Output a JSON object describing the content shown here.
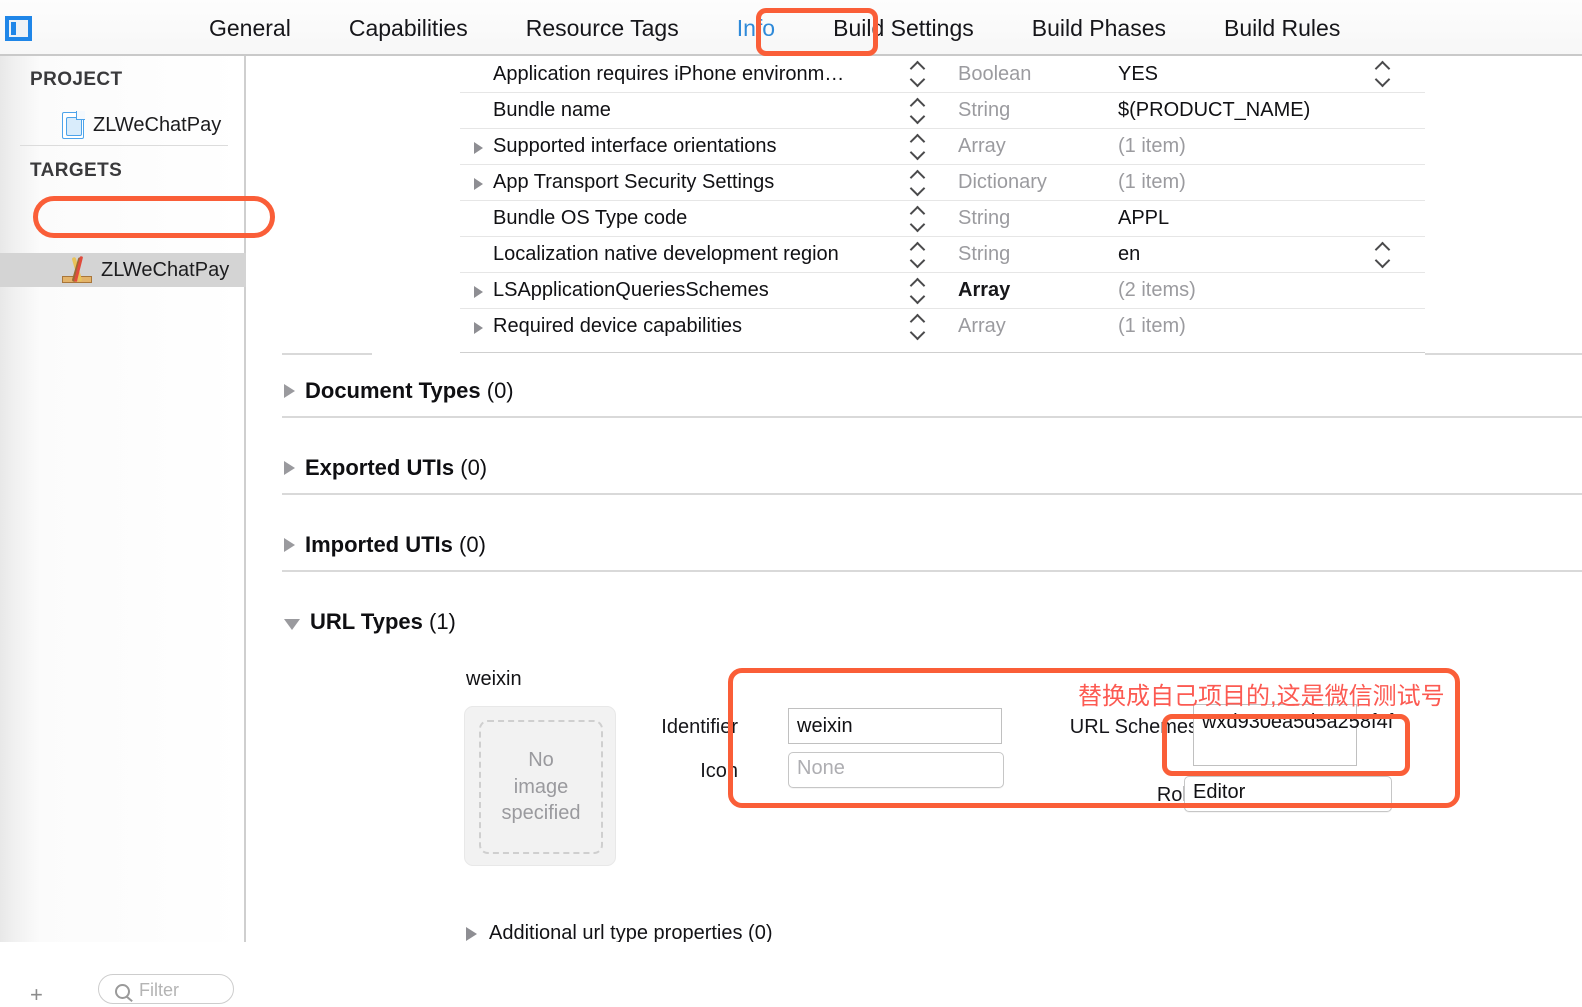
{
  "window": {
    "sidebar_toggle_icon": "sidebar-toggle-icon"
  },
  "tabs": [
    {
      "label": "General",
      "active": false
    },
    {
      "label": "Capabilities",
      "active": false
    },
    {
      "label": "Resource Tags",
      "active": false
    },
    {
      "label": "Info",
      "active": true
    },
    {
      "label": "Build Settings",
      "active": false
    },
    {
      "label": "Build Phases",
      "active": false
    },
    {
      "label": "Build Rules",
      "active": false
    }
  ],
  "sidebar": {
    "project_header": "PROJECT",
    "project_item": {
      "label": "ZLWeChatPay",
      "icon": "xcode-project-icon"
    },
    "targets_header": "TARGETS",
    "target_item": {
      "label": "ZLWeChatPay",
      "icon": "app-target-icon",
      "selected": true
    },
    "filter_placeholder": "Filter",
    "filter_icon": "search-icon",
    "add_button": "+"
  },
  "plist": {
    "rows": [
      {
        "key": "Application requires iPhone environm…",
        "type": "Boolean",
        "value": "YES",
        "type_strong": false,
        "value_muted": false,
        "disclosure": false,
        "value_stepper": true
      },
      {
        "key": "Bundle name",
        "type": "String",
        "value": "$(PRODUCT_NAME)",
        "type_strong": false,
        "value_muted": false,
        "disclosure": false,
        "value_stepper": false
      },
      {
        "key": "Supported interface orientations",
        "type": "Array",
        "value": "(1 item)",
        "type_strong": false,
        "value_muted": true,
        "disclosure": true,
        "value_stepper": false
      },
      {
        "key": "App Transport Security Settings",
        "type": "Dictionary",
        "value": "(1 item)",
        "type_strong": false,
        "value_muted": true,
        "disclosure": true,
        "value_stepper": false
      },
      {
        "key": "Bundle OS Type code",
        "type": "String",
        "value": "APPL",
        "type_strong": false,
        "value_muted": false,
        "disclosure": false,
        "value_stepper": false
      },
      {
        "key": "Localization native development region",
        "type": "String",
        "value": "en",
        "type_strong": false,
        "value_muted": false,
        "disclosure": false,
        "value_stepper": true
      },
      {
        "key": "LSApplicationQueriesSchemes",
        "type": "Array",
        "value": "(2 items)",
        "type_strong": true,
        "value_muted": true,
        "disclosure": true,
        "value_stepper": false
      },
      {
        "key": "Required device capabilities",
        "type": "Array",
        "value": "(1 item)",
        "type_strong": false,
        "value_muted": true,
        "disclosure": true,
        "value_stepper": false
      }
    ]
  },
  "sections": [
    {
      "title": "Document Types ",
      "count": "(0)",
      "expanded": false
    },
    {
      "title": "Exported UTIs ",
      "count": "(0)",
      "expanded": false
    },
    {
      "title": "Imported UTIs ",
      "count": "(0)",
      "expanded": false
    },
    {
      "title": "URL Types ",
      "count": "(1)",
      "expanded": true
    }
  ],
  "url_type": {
    "name": "weixin",
    "image_well_text": "No\nimage\nspecified",
    "image_well_line1": "No",
    "image_well_line2": "image",
    "image_well_line3": "specified",
    "identifier_label": "Identifier",
    "identifier_value": "weixin",
    "icon_label": "Icon",
    "icon_value": "None",
    "url_schemes_label": "URL Schemes",
    "url_schemes_value": "wxd930ea5d5a258f4f",
    "role_label": "Role",
    "role_value": "Editor",
    "additional_props_label": "Additional url type properties (0)",
    "add_button": "+"
  },
  "annotations": {
    "note_text": "替换成自己项目的,这是微信测试号",
    "accent_color": "#fa5e38",
    "note_color": "#fc5a52"
  },
  "colors": {
    "active_tab": "#2f8ad9",
    "selection": "#d4d4d4"
  }
}
